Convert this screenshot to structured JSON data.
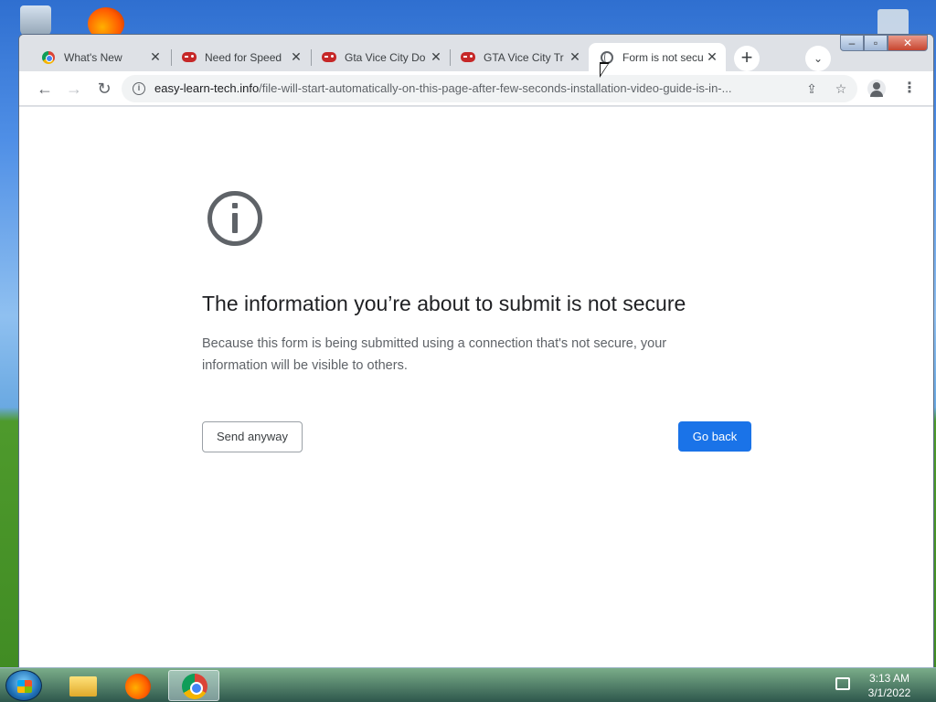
{
  "tabs": [
    {
      "title": "What's New",
      "icon": "chrome-icon"
    },
    {
      "title": "Need for Speed",
      "icon": "gamepad-icon"
    },
    {
      "title": "Gta Vice City Do",
      "icon": "gamepad-icon"
    },
    {
      "title": "GTA Vice City Tr",
      "icon": "gamepad-icon"
    },
    {
      "title": "Form is not secu",
      "icon": "globe-icon",
      "active": true
    }
  ],
  "toolbar": {
    "url_host": "easy-learn-tech.info",
    "url_path": "/file-will-start-automatically-on-this-page-after-few-seconds-installation-video-guide-is-in-..."
  },
  "page": {
    "heading": "The information you’re about to submit is not secure",
    "description": "Because this form is being submitted using a connection that's not secure, your information will be visible to others.",
    "send_anyway": "Send anyway",
    "go_back": "Go back"
  },
  "taskbar": {
    "time": "3:13 AM",
    "date": "3/1/2022"
  },
  "colors": {
    "accent": "#1a73e8",
    "heading": "#202124",
    "body_text": "#5f6368"
  }
}
